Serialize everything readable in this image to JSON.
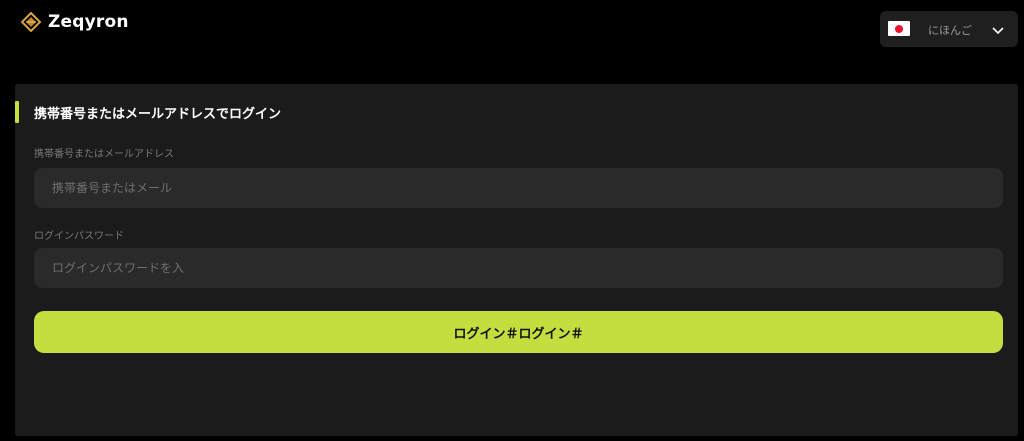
{
  "header": {
    "brand_name": "Zeqyron",
    "brand_icon": "diamond-logo-icon",
    "language": {
      "label": "にほんご",
      "flag_icon": "japan-flag-icon",
      "chevron_icon": "chevron-down-icon"
    }
  },
  "login": {
    "title": "携帯番号またはメールアドレスでログイン",
    "account_field": {
      "label": "携帯番号またはメールアドレス",
      "placeholder": "携帯番号またはメール",
      "value": ""
    },
    "password_field": {
      "label": "ログインパスワード",
      "placeholder": "ログインパスワードを入",
      "value": ""
    },
    "submit_label": "ログイン＃ログイン＃"
  },
  "colors": {
    "background": "#000000",
    "panel": "#1b1b1b",
    "input": "#2a2a2a",
    "accent": "#c3de3e",
    "flag_red": "#e8142a"
  }
}
